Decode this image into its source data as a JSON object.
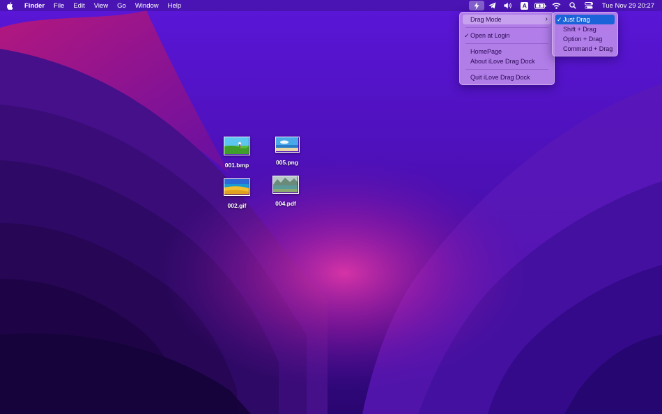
{
  "menubar": {
    "app_name": "Finder",
    "menus": [
      "File",
      "Edit",
      "View",
      "Go",
      "Window",
      "Help"
    ],
    "status_icons": [
      "drag-dock-icon",
      "telegram-icon",
      "volume-icon",
      "input-source-icon",
      "battery-icon",
      "wifi-icon",
      "spotlight-icon",
      "control-center-icon"
    ],
    "input_source_letter": "A",
    "clock": "Tue Nov 29  20:27"
  },
  "drag_dock_menu": {
    "drag_mode": "Drag Mode",
    "open_at_login": "Open at Login",
    "open_at_login_checked": true,
    "homepage": "HomePage",
    "about": "About iLove Drag Dock",
    "quit": "Quit iLove Drag Dock"
  },
  "drag_mode_submenu": {
    "options": [
      "Just Drag",
      "Shift + Drag",
      "Option + Drag",
      "Command + Drag"
    ],
    "selected": "Just Drag"
  },
  "desktop_files": [
    "001.bmp",
    "005.png",
    "002.gif",
    "004.pdf"
  ],
  "colors": {
    "wallpaper_top": "#4a10c8",
    "wallpaper_bottom": "#1a0540",
    "accent_pink": "#d0208a",
    "menu_bg": "#be8ceb",
    "selection_blue": "#1a63d8"
  }
}
